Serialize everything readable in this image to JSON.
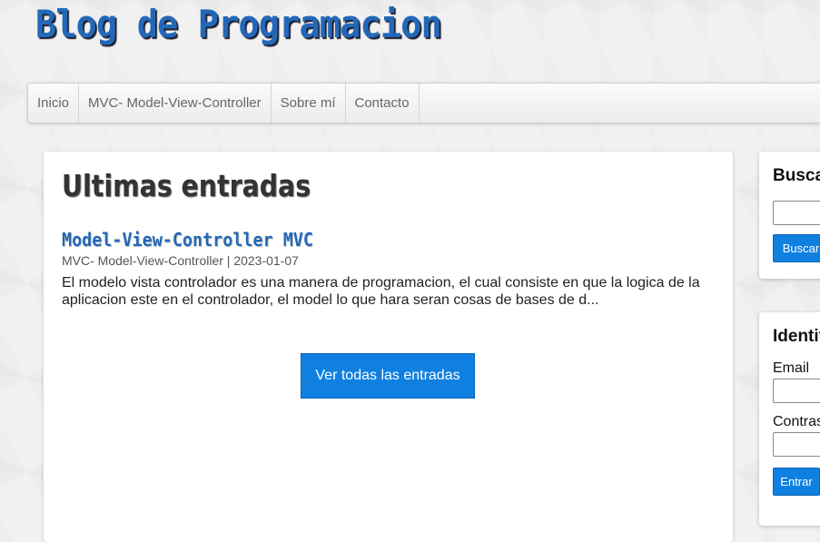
{
  "site": {
    "title": "Blog de Programacion"
  },
  "nav": {
    "items": [
      {
        "label": "Inicio"
      },
      {
        "label": "MVC- Model-View-Controller"
      },
      {
        "label": "Sobre mí"
      },
      {
        "label": "Contacto"
      }
    ]
  },
  "main": {
    "section_title": "Ultimas entradas",
    "posts": [
      {
        "title": "Model-View-Controller MVC",
        "category": "MVC- Model-View-Controller",
        "separator": "|",
        "date": "2023-01-07",
        "excerpt": "El modelo vista controlador es una manera de programacion, el cual consiste en que la logica de la aplicacion este en el controlador, el model lo que hara seran cosas de bases de d..."
      }
    ],
    "view_all_label": "Ver todas las entradas"
  },
  "sidebar": {
    "search": {
      "title": "Buscar",
      "input_value": "",
      "button_label": "Buscar"
    },
    "login": {
      "title": "Identificate",
      "email_label": "Email",
      "email_value": "",
      "password_label": "Contraseña",
      "password_value": "",
      "submit_label": "Entrar"
    }
  },
  "colors": {
    "brand_blue": "#2368b8",
    "button_blue": "#0f80e0"
  }
}
